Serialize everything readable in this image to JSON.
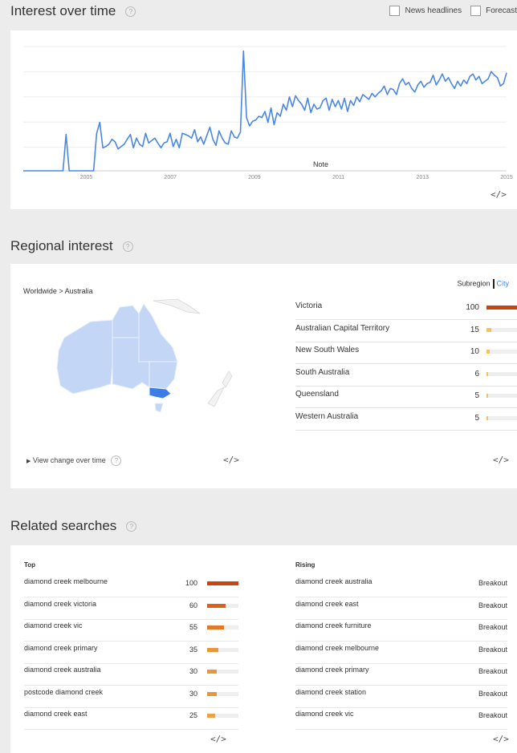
{
  "interest": {
    "title": "Interest over time",
    "help": "?",
    "news_label": "News headlines",
    "forecast_label": "Forecast",
    "note": "Note",
    "embed": "</>",
    "x_labels": [
      "2005",
      "2007",
      "2009",
      "2011",
      "2013",
      "2015"
    ],
    "chart_data": {
      "type": "line",
      "xlabel": "",
      "ylabel": "",
      "x_range": [
        2004,
        2015.5
      ],
      "ylim": [
        0,
        100
      ],
      "grid": true,
      "series": [
        {
          "color": "#4a87e2",
          "values": [
            0,
            0,
            0,
            0,
            0,
            0,
            0,
            0,
            0,
            0,
            0,
            0,
            0,
            0,
            30,
            0,
            0,
            0,
            0,
            0,
            0,
            0,
            0,
            0,
            31,
            40,
            19,
            20,
            22,
            26,
            24,
            18,
            20,
            22,
            26,
            30,
            19,
            27,
            22,
            20,
            31,
            23,
            25,
            27,
            23,
            19,
            23,
            24,
            31,
            20,
            26,
            19,
            31,
            30,
            29,
            27,
            34,
            24,
            28,
            22,
            29,
            36,
            26,
            21,
            33,
            27,
            23,
            22,
            33,
            28,
            27,
            32,
            99,
            44,
            37,
            41,
            42,
            45,
            44,
            49,
            40,
            52,
            38,
            48,
            45,
            55,
            50,
            61,
            53,
            62,
            58,
            55,
            50,
            60,
            48,
            55,
            51,
            52,
            58,
            60,
            50,
            59,
            53,
            58,
            51,
            60,
            49,
            58,
            54,
            61,
            57,
            63,
            61,
            59,
            64,
            61,
            64,
            66,
            70,
            63,
            68,
            67,
            63,
            72,
            76,
            71,
            73,
            68,
            65,
            71,
            74,
            69,
            72,
            73,
            79,
            71,
            75,
            80,
            74,
            77,
            72,
            68,
            74,
            70,
            75,
            72,
            78,
            80,
            75,
            78,
            72,
            74,
            76,
            82,
            79,
            77,
            70,
            72,
            81
          ]
        }
      ]
    }
  },
  "regional": {
    "title": "Regional interest",
    "help": "?",
    "breadcrumb": "Worldwide > Australia",
    "subregion_label": "Subregion",
    "city_label": "City",
    "view_change": "View change over time",
    "embed_left": "</>",
    "embed_right": "</>",
    "rows": [
      {
        "name": "Victoria",
        "value": "100",
        "pct": 100,
        "color": "#c8450f"
      },
      {
        "name": "Australian Capital Territory",
        "value": "15",
        "pct": 15,
        "color": "#f6c25a"
      },
      {
        "name": "New South Wales",
        "value": "10",
        "pct": 10,
        "color": "#f6c25a"
      },
      {
        "name": "South Australia",
        "value": "6",
        "pct": 6,
        "color": "#f6c25a"
      },
      {
        "name": "Queensland",
        "value": "5",
        "pct": 5,
        "color": "#f6c25a"
      },
      {
        "name": "Western Australia",
        "value": "5",
        "pct": 5,
        "color": "#f6c25a"
      }
    ]
  },
  "related": {
    "title": "Related searches",
    "help": "?",
    "top_label": "Top",
    "rising_label": "Rising",
    "embed_left": "</>",
    "embed_right": "</>",
    "top": [
      {
        "name": "diamond creek melbourne",
        "value": "100",
        "pct": 100,
        "color": "#c8450f"
      },
      {
        "name": "diamond creek victoria",
        "value": "60",
        "pct": 60,
        "color": "#d9621c"
      },
      {
        "name": "diamond creek vic",
        "value": "55",
        "pct": 55,
        "color": "#e07a2a"
      },
      {
        "name": "diamond creek primary",
        "value": "35",
        "pct": 35,
        "color": "#e8953c"
      },
      {
        "name": "diamond creek australia",
        "value": "30",
        "pct": 30,
        "color": "#e8953c"
      },
      {
        "name": "postcode diamond creek",
        "value": "30",
        "pct": 30,
        "color": "#e8953c"
      },
      {
        "name": "diamond creek east",
        "value": "25",
        "pct": 25,
        "color": "#eda140"
      }
    ],
    "rising": [
      {
        "name": "diamond creek australia",
        "value": "Breakout"
      },
      {
        "name": "diamond creek east",
        "value": "Breakout"
      },
      {
        "name": "diamond creek furniture",
        "value": "Breakout"
      },
      {
        "name": "diamond creek melbourne",
        "value": "Breakout"
      },
      {
        "name": "diamond creek primary",
        "value": "Breakout"
      },
      {
        "name": "diamond creek station",
        "value": "Breakout"
      },
      {
        "name": "diamond creek vic",
        "value": "Breakout"
      }
    ]
  },
  "colors": {
    "line": "#4a87e2",
    "map_base": "#c4d6f5",
    "map_highlight": "#3b7de6"
  }
}
